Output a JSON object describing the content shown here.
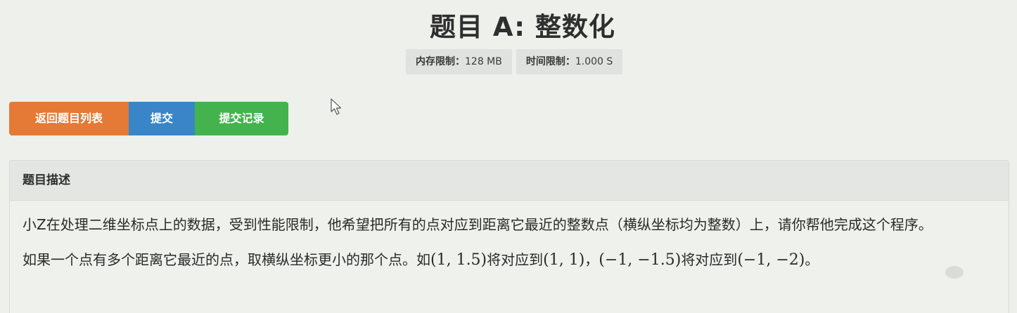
{
  "problem": {
    "title": "题目 A: 整数化"
  },
  "limits": {
    "memory_label": "内存限制：",
    "memory_value": "128 MB",
    "time_label": "时间限制：",
    "time_value": "1.000 S"
  },
  "actions": {
    "back_label": "返回题目列表",
    "submit_label": "提交",
    "records_label": "提交记录"
  },
  "description": {
    "header": "题目描述",
    "para1": "小Z在处理二维坐标点上的数据，受到性能限制，他希望把所有的点对应到距离它最近的整数点（横纵坐标均为整数）上，请你帮他完成这个程序。",
    "para2_text1": "如果一个点有多个距离它最近的点，取横纵坐标更小的那个点。如",
    "para2_math1": "(1, 1.5)",
    "para2_text2": "将对应到",
    "para2_math2": "(1, 1)",
    "para2_text3": "，",
    "para2_math3": "(−1, −1.5)",
    "para2_text4": "将对应到",
    "para2_math4": "(−1, −2)",
    "para2_text5": "。"
  },
  "colors": {
    "back_button": "#e47a35",
    "submit_button": "#3a85c7",
    "records_button": "#45b34d",
    "background": "#edf0eb"
  },
  "icons": {
    "cursor": "mouse-pointer-icon",
    "watermark": "watermark-logo-icon"
  }
}
